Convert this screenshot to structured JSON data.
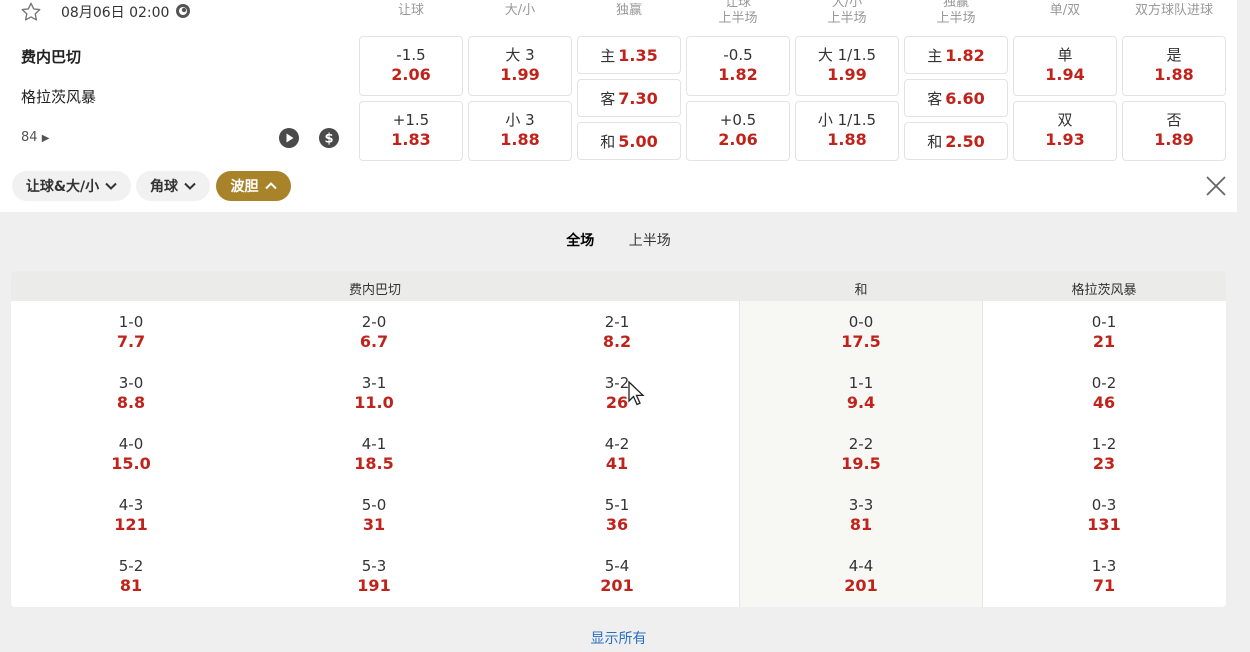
{
  "match": {
    "datetime": "08月06日 02:00",
    "home": "费内巴切",
    "away": "格拉茨风暴",
    "market_count": "84"
  },
  "columns": [
    "让球",
    "大/小",
    "独赢",
    "让球\n上半场",
    "大/小\n上半场",
    "独赢\n上半场",
    "单/双",
    "双方球队进球"
  ],
  "odds": {
    "hdp": [
      {
        "line": "-1.5",
        "odd": "2.06"
      },
      {
        "line": "+1.5",
        "odd": "1.83"
      }
    ],
    "ou": [
      {
        "line": "大 3",
        "odd": "1.99"
      },
      {
        "line": "小 3",
        "odd": "1.88"
      }
    ],
    "ml": [
      {
        "line": "主",
        "odd": "1.35"
      },
      {
        "line": "客",
        "odd": "7.30"
      },
      {
        "line": "和",
        "odd": "5.00"
      }
    ],
    "hdp_1h": [
      {
        "line": "-0.5",
        "odd": "1.82"
      },
      {
        "line": "+0.5",
        "odd": "2.06"
      }
    ],
    "ou_1h": [
      {
        "line": "大 1/1.5",
        "odd": "1.99"
      },
      {
        "line": "小 1/1.5",
        "odd": "1.88"
      }
    ],
    "ml_1h": [
      {
        "line": "主",
        "odd": "1.82"
      },
      {
        "line": "客",
        "odd": "6.60"
      },
      {
        "line": "和",
        "odd": "2.50"
      }
    ],
    "oe": [
      {
        "line": "单",
        "odd": "1.94"
      },
      {
        "line": "双",
        "odd": "1.93"
      }
    ],
    "btts": [
      {
        "line": "是",
        "odd": "1.88"
      },
      {
        "line": "否",
        "odd": "1.89"
      }
    ]
  },
  "filters": [
    {
      "label": "让球&大/小",
      "active": false
    },
    {
      "label": "角球",
      "active": false
    },
    {
      "label": "波胆",
      "active": true
    }
  ],
  "tabs": [
    "全场",
    "上半场"
  ],
  "correct_score": {
    "headers": {
      "home": "费内巴切",
      "draw": "和",
      "away": "格拉茨风暴"
    },
    "columns": [
      [
        {
          "s": "1-0",
          "o": "7.7"
        },
        {
          "s": "3-0",
          "o": "8.8"
        },
        {
          "s": "4-0",
          "o": "15.0"
        },
        {
          "s": "4-3",
          "o": "121"
        },
        {
          "s": "5-2",
          "o": "81"
        }
      ],
      [
        {
          "s": "2-0",
          "o": "6.7"
        },
        {
          "s": "3-1",
          "o": "11.0"
        },
        {
          "s": "4-1",
          "o": "18.5"
        },
        {
          "s": "5-0",
          "o": "31"
        },
        {
          "s": "5-3",
          "o": "191"
        }
      ],
      [
        {
          "s": "2-1",
          "o": "8.2"
        },
        {
          "s": "3-2",
          "o": "26"
        },
        {
          "s": "4-2",
          "o": "41"
        },
        {
          "s": "5-1",
          "o": "36"
        },
        {
          "s": "5-4",
          "o": "201"
        }
      ],
      [
        {
          "s": "0-0",
          "o": "17.5"
        },
        {
          "s": "1-1",
          "o": "9.4"
        },
        {
          "s": "2-2",
          "o": "19.5"
        },
        {
          "s": "3-3",
          "o": "81"
        },
        {
          "s": "4-4",
          "o": "201"
        }
      ],
      [
        {
          "s": "0-1",
          "o": "21"
        },
        {
          "s": "0-2",
          "o": "46"
        },
        {
          "s": "1-2",
          "o": "23"
        },
        {
          "s": "0-3",
          "o": "131"
        },
        {
          "s": "1-3",
          "o": "71"
        }
      ]
    ]
  },
  "show_all": "显示所有",
  "colors": {
    "odd": "#c0231b",
    "accent": "#a8832a",
    "link": "#2a70c2"
  }
}
